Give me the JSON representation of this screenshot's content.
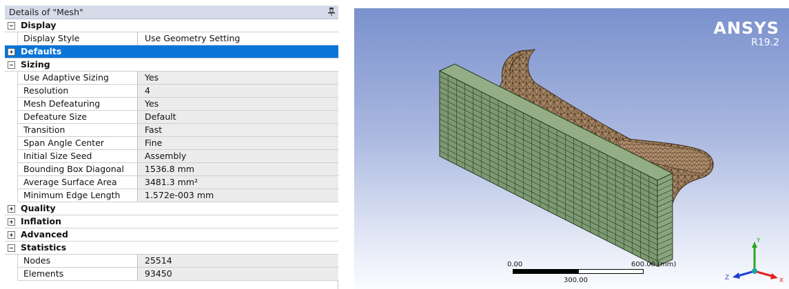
{
  "panel": {
    "title": "Details of \"Mesh\"",
    "pin_icon": "pin-icon"
  },
  "groups": [
    {
      "label": "Display",
      "expander": "minus",
      "selected": false,
      "props": [
        {
          "name": "Display Style",
          "value": "Use Geometry Setting"
        }
      ]
    },
    {
      "label": "Defaults",
      "expander": "plus",
      "selected": true,
      "props": []
    },
    {
      "label": "Sizing",
      "expander": "minus",
      "selected": false,
      "props": [
        {
          "name": "Use Adaptive Sizing",
          "value": "Yes"
        },
        {
          "name": "Resolution",
          "value": "4"
        },
        {
          "name": "Mesh Defeaturing",
          "value": "Yes"
        },
        {
          "name": "Defeature Size",
          "value": "Default"
        },
        {
          "name": "Transition",
          "value": "Fast"
        },
        {
          "name": "Span Angle Center",
          "value": "Fine"
        },
        {
          "name": "Initial Size Seed",
          "value": "Assembly"
        },
        {
          "name": "Bounding Box Diagonal",
          "value": "1536.8 mm"
        },
        {
          "name": "Average Surface Area",
          "value": "3481.3 mm²"
        },
        {
          "name": "Minimum Edge Length",
          "value": "1.572e-003 mm"
        }
      ]
    },
    {
      "label": "Quality",
      "expander": "plus",
      "selected": false,
      "props": []
    },
    {
      "label": "Inflation",
      "expander": "plus",
      "selected": false,
      "props": []
    },
    {
      "label": "Advanced",
      "expander": "plus",
      "selected": false,
      "props": []
    },
    {
      "label": "Statistics",
      "expander": "minus",
      "selected": false,
      "props": [
        {
          "name": "Nodes",
          "value": "25514"
        },
        {
          "name": "Elements",
          "value": "93450"
        }
      ]
    }
  ],
  "viewport": {
    "brand_name": "ANSYS",
    "brand_version": "R19.2",
    "scale": {
      "left": "0.00",
      "right": "600.00 (mm)",
      "mid": "300.00"
    },
    "axes": {
      "x": "X",
      "y": "Y",
      "z": "Z"
    },
    "colors": {
      "plate_fill": "#7e9972",
      "plate_lines": "#1f3a1c",
      "part_fill": "#a58664",
      "part_lines": "#3e2916",
      "x_axis": "#e21f1f",
      "y_axis": "#2aa61e",
      "z_axis": "#1f3fd6",
      "selection": "#0a75d8"
    }
  }
}
